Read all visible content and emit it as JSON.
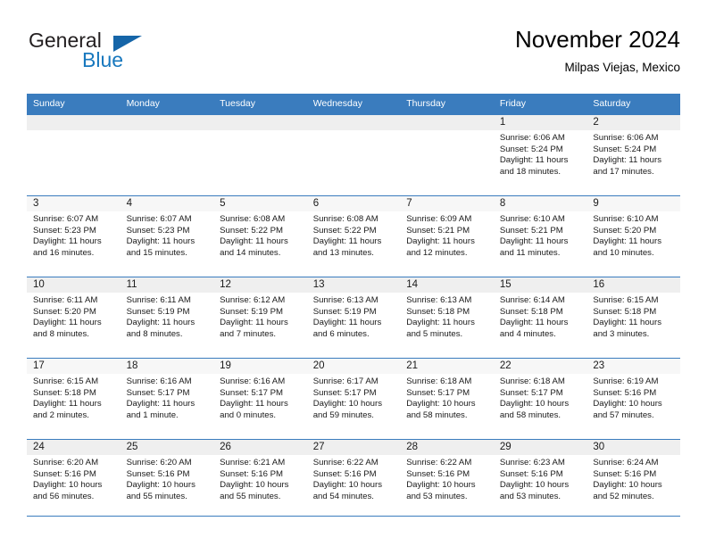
{
  "brand": {
    "name_part1": "General",
    "name_part2": "Blue",
    "accent_color": "#1878be",
    "triangle_color": "#1565a8"
  },
  "header": {
    "title": "November 2024",
    "subtitle": "Milpas Viejas, Mexico"
  },
  "calendar": {
    "header_bg": "#3a7cbe",
    "weekdays": [
      "Sunday",
      "Monday",
      "Tuesday",
      "Wednesday",
      "Thursday",
      "Friday",
      "Saturday"
    ],
    "weeks": [
      [
        {
          "day": "",
          "empty": true,
          "sunrise": "",
          "sunset": "",
          "daylight1": "",
          "daylight2": ""
        },
        {
          "day": "",
          "empty": true,
          "sunrise": "",
          "sunset": "",
          "daylight1": "",
          "daylight2": ""
        },
        {
          "day": "",
          "empty": true,
          "sunrise": "",
          "sunset": "",
          "daylight1": "",
          "daylight2": ""
        },
        {
          "day": "",
          "empty": true,
          "sunrise": "",
          "sunset": "",
          "daylight1": "",
          "daylight2": ""
        },
        {
          "day": "",
          "empty": true,
          "sunrise": "",
          "sunset": "",
          "daylight1": "",
          "daylight2": ""
        },
        {
          "day": "1",
          "sunrise": "Sunrise: 6:06 AM",
          "sunset": "Sunset: 5:24 PM",
          "daylight1": "Daylight: 11 hours",
          "daylight2": "and 18 minutes."
        },
        {
          "day": "2",
          "sunrise": "Sunrise: 6:06 AM",
          "sunset": "Sunset: 5:24 PM",
          "daylight1": "Daylight: 11 hours",
          "daylight2": "and 17 minutes."
        }
      ],
      [
        {
          "day": "3",
          "sunrise": "Sunrise: 6:07 AM",
          "sunset": "Sunset: 5:23 PM",
          "daylight1": "Daylight: 11 hours",
          "daylight2": "and 16 minutes."
        },
        {
          "day": "4",
          "sunrise": "Sunrise: 6:07 AM",
          "sunset": "Sunset: 5:23 PM",
          "daylight1": "Daylight: 11 hours",
          "daylight2": "and 15 minutes."
        },
        {
          "day": "5",
          "sunrise": "Sunrise: 6:08 AM",
          "sunset": "Sunset: 5:22 PM",
          "daylight1": "Daylight: 11 hours",
          "daylight2": "and 14 minutes."
        },
        {
          "day": "6",
          "sunrise": "Sunrise: 6:08 AM",
          "sunset": "Sunset: 5:22 PM",
          "daylight1": "Daylight: 11 hours",
          "daylight2": "and 13 minutes."
        },
        {
          "day": "7",
          "sunrise": "Sunrise: 6:09 AM",
          "sunset": "Sunset: 5:21 PM",
          "daylight1": "Daylight: 11 hours",
          "daylight2": "and 12 minutes."
        },
        {
          "day": "8",
          "sunrise": "Sunrise: 6:10 AM",
          "sunset": "Sunset: 5:21 PM",
          "daylight1": "Daylight: 11 hours",
          "daylight2": "and 11 minutes."
        },
        {
          "day": "9",
          "sunrise": "Sunrise: 6:10 AM",
          "sunset": "Sunset: 5:20 PM",
          "daylight1": "Daylight: 11 hours",
          "daylight2": "and 10 minutes."
        }
      ],
      [
        {
          "day": "10",
          "sunrise": "Sunrise: 6:11 AM",
          "sunset": "Sunset: 5:20 PM",
          "daylight1": "Daylight: 11 hours",
          "daylight2": "and 8 minutes."
        },
        {
          "day": "11",
          "sunrise": "Sunrise: 6:11 AM",
          "sunset": "Sunset: 5:19 PM",
          "daylight1": "Daylight: 11 hours",
          "daylight2": "and 8 minutes."
        },
        {
          "day": "12",
          "sunrise": "Sunrise: 6:12 AM",
          "sunset": "Sunset: 5:19 PM",
          "daylight1": "Daylight: 11 hours",
          "daylight2": "and 7 minutes."
        },
        {
          "day": "13",
          "sunrise": "Sunrise: 6:13 AM",
          "sunset": "Sunset: 5:19 PM",
          "daylight1": "Daylight: 11 hours",
          "daylight2": "and 6 minutes."
        },
        {
          "day": "14",
          "sunrise": "Sunrise: 6:13 AM",
          "sunset": "Sunset: 5:18 PM",
          "daylight1": "Daylight: 11 hours",
          "daylight2": "and 5 minutes."
        },
        {
          "day": "15",
          "sunrise": "Sunrise: 6:14 AM",
          "sunset": "Sunset: 5:18 PM",
          "daylight1": "Daylight: 11 hours",
          "daylight2": "and 4 minutes."
        },
        {
          "day": "16",
          "sunrise": "Sunrise: 6:15 AM",
          "sunset": "Sunset: 5:18 PM",
          "daylight1": "Daylight: 11 hours",
          "daylight2": "and 3 minutes."
        }
      ],
      [
        {
          "day": "17",
          "sunrise": "Sunrise: 6:15 AM",
          "sunset": "Sunset: 5:18 PM",
          "daylight1": "Daylight: 11 hours",
          "daylight2": "and 2 minutes."
        },
        {
          "day": "18",
          "sunrise": "Sunrise: 6:16 AM",
          "sunset": "Sunset: 5:17 PM",
          "daylight1": "Daylight: 11 hours",
          "daylight2": "and 1 minute."
        },
        {
          "day": "19",
          "sunrise": "Sunrise: 6:16 AM",
          "sunset": "Sunset: 5:17 PM",
          "daylight1": "Daylight: 11 hours",
          "daylight2": "and 0 minutes."
        },
        {
          "day": "20",
          "sunrise": "Sunrise: 6:17 AM",
          "sunset": "Sunset: 5:17 PM",
          "daylight1": "Daylight: 10 hours",
          "daylight2": "and 59 minutes."
        },
        {
          "day": "21",
          "sunrise": "Sunrise: 6:18 AM",
          "sunset": "Sunset: 5:17 PM",
          "daylight1": "Daylight: 10 hours",
          "daylight2": "and 58 minutes."
        },
        {
          "day": "22",
          "sunrise": "Sunrise: 6:18 AM",
          "sunset": "Sunset: 5:17 PM",
          "daylight1": "Daylight: 10 hours",
          "daylight2": "and 58 minutes."
        },
        {
          "day": "23",
          "sunrise": "Sunrise: 6:19 AM",
          "sunset": "Sunset: 5:16 PM",
          "daylight1": "Daylight: 10 hours",
          "daylight2": "and 57 minutes."
        }
      ],
      [
        {
          "day": "24",
          "sunrise": "Sunrise: 6:20 AM",
          "sunset": "Sunset: 5:16 PM",
          "daylight1": "Daylight: 10 hours",
          "daylight2": "and 56 minutes."
        },
        {
          "day": "25",
          "sunrise": "Sunrise: 6:20 AM",
          "sunset": "Sunset: 5:16 PM",
          "daylight1": "Daylight: 10 hours",
          "daylight2": "and 55 minutes."
        },
        {
          "day": "26",
          "sunrise": "Sunrise: 6:21 AM",
          "sunset": "Sunset: 5:16 PM",
          "daylight1": "Daylight: 10 hours",
          "daylight2": "and 55 minutes."
        },
        {
          "day": "27",
          "sunrise": "Sunrise: 6:22 AM",
          "sunset": "Sunset: 5:16 PM",
          "daylight1": "Daylight: 10 hours",
          "daylight2": "and 54 minutes."
        },
        {
          "day": "28",
          "sunrise": "Sunrise: 6:22 AM",
          "sunset": "Sunset: 5:16 PM",
          "daylight1": "Daylight: 10 hours",
          "daylight2": "and 53 minutes."
        },
        {
          "day": "29",
          "sunrise": "Sunrise: 6:23 AM",
          "sunset": "Sunset: 5:16 PM",
          "daylight1": "Daylight: 10 hours",
          "daylight2": "and 53 minutes."
        },
        {
          "day": "30",
          "sunrise": "Sunrise: 6:24 AM",
          "sunset": "Sunset: 5:16 PM",
          "daylight1": "Daylight: 10 hours",
          "daylight2": "and 52 minutes."
        }
      ]
    ]
  }
}
